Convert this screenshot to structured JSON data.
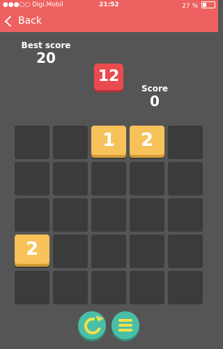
{
  "status_bar": {
    "carrier": "●●●○○ Digi.Mobil",
    "time": "21:52",
    "battery": "27 %"
  },
  "header": {
    "back_label": "Back",
    "color": "#ee6161"
  },
  "scores": {
    "best_label": "Best score",
    "best_value": "20",
    "score_label": "Score",
    "score_value": "0"
  },
  "next_tile": {
    "value": "12",
    "color": "#e94b4f"
  },
  "board": {
    "rows": 5,
    "cols": 5,
    "tiles": [
      {
        "row": 0,
        "col": 2,
        "value": "1"
      },
      {
        "row": 0,
        "col": 3,
        "value": "2"
      },
      {
        "row": 3,
        "col": 0,
        "value": "2"
      }
    ],
    "tile_color": "#f7c25a"
  },
  "controls": {
    "restart_icon": "restart-icon",
    "menu_icon": "menu-icon",
    "button_color": "#4bbfa6",
    "icon_color": "#f4e14a"
  }
}
